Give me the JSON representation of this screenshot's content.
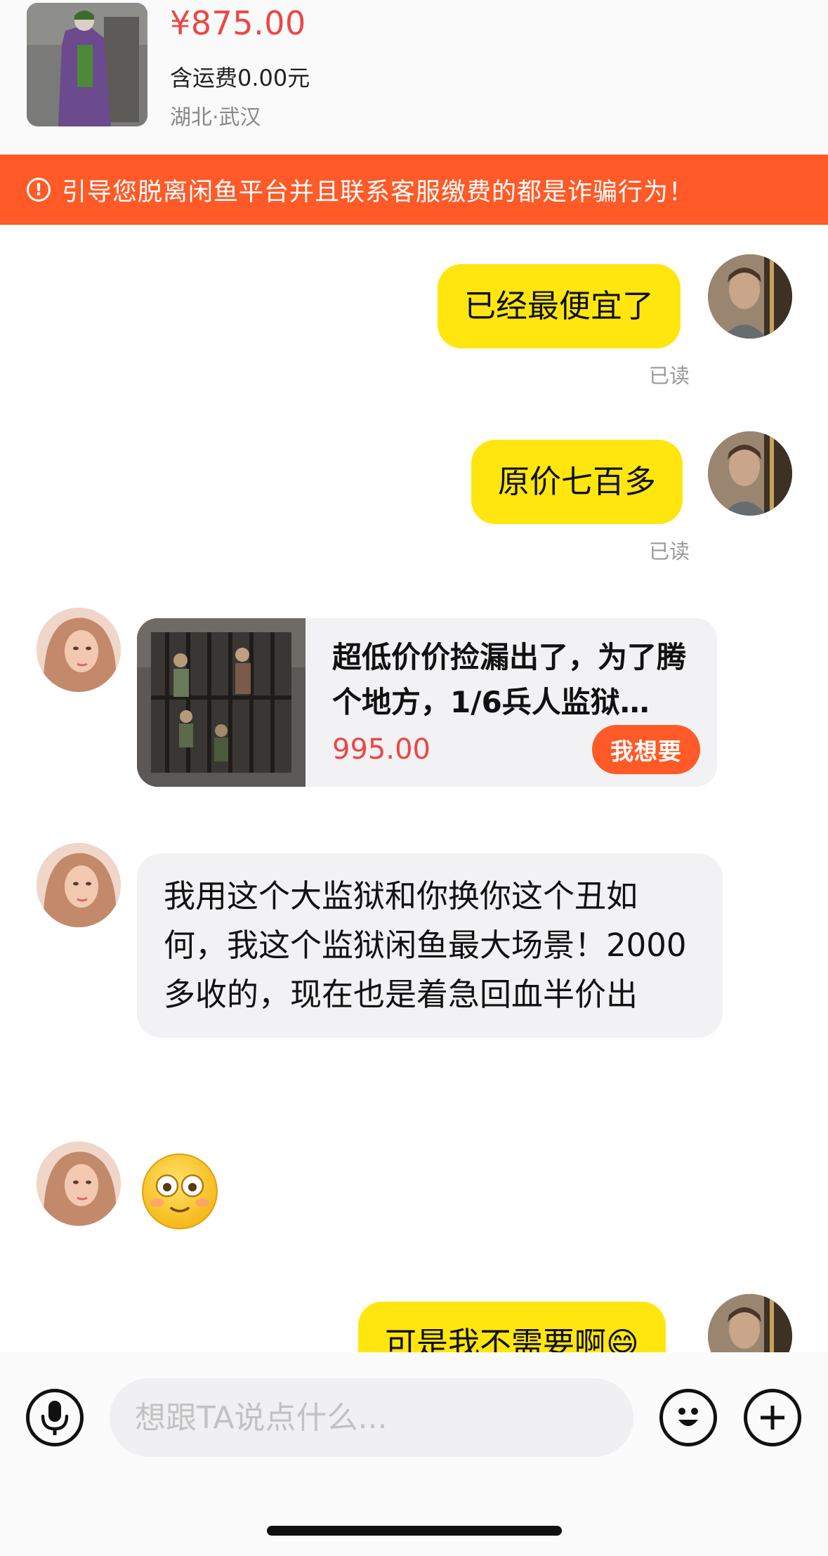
{
  "product": {
    "price": "¥875.00",
    "shipping": "含运费0.00元",
    "location": "湖北·武汉"
  },
  "warning": {
    "icon": "exclamation-circle-icon",
    "text": "引导您脱离闲鱼平台并且联系客服缴费的都是诈骗行为！"
  },
  "messages": [
    {
      "from": "me",
      "text": "已经最便宜了",
      "status": "已读"
    },
    {
      "from": "me",
      "text": "原价七百多",
      "status": "已读"
    },
    {
      "from": "other",
      "type": "product_card",
      "title": "超低价价捡漏出了，为了腾个地方，1/6兵人监狱…",
      "price": "995.00",
      "button": "我想要"
    },
    {
      "from": "other",
      "text": "我用这个大监狱和你换你这个丑如何，我这个监狱闲鱼最大场景！2000多收的，现在也是着急回血半价出"
    },
    {
      "from": "other",
      "type": "emoji",
      "icon": "flushed-face-emoji"
    },
    {
      "from": "me",
      "text": "可是我不需要啊😄"
    }
  ],
  "input": {
    "placeholder": "想跟TA说点什么...",
    "voice_icon": "microphone-icon",
    "emoji_icon": "smiley-face-icon",
    "more_icon": "plus-circle-icon"
  },
  "colors": {
    "accent": "#ff5a27",
    "price_red": "#ee4545",
    "my_bubble": "#ffe60f",
    "their_bubble": "#f2f2f4"
  }
}
